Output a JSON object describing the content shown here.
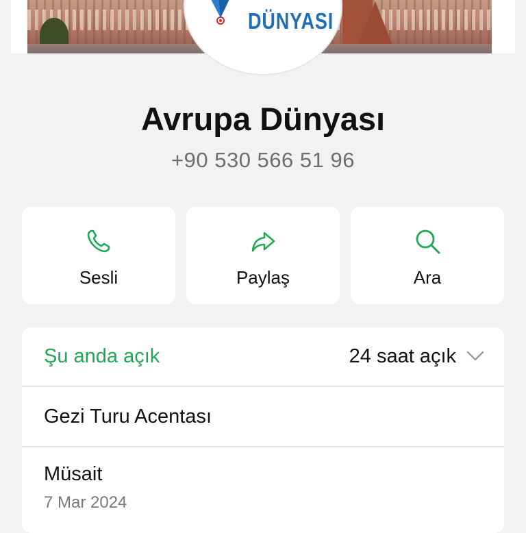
{
  "profile": {
    "name": "Avrupa Dünyası",
    "phone": "+90 530 566 51 96",
    "logo_text": "DÜNYASI"
  },
  "actions": [
    {
      "label": "Sesli",
      "icon": "phone-icon"
    },
    {
      "label": "Paylaş",
      "icon": "share-icon"
    },
    {
      "label": "Ara",
      "icon": "search-icon"
    }
  ],
  "hours": {
    "status": "Şu anda açık",
    "value": "24 saat açık"
  },
  "category": "Gezi Turu Acentası",
  "availability": {
    "label": "Müsait",
    "date": "7 Mar 2024"
  },
  "colors": {
    "accent": "#1fa855",
    "background": "#f2f2f2",
    "logo_blue": "#1e6fb8"
  }
}
